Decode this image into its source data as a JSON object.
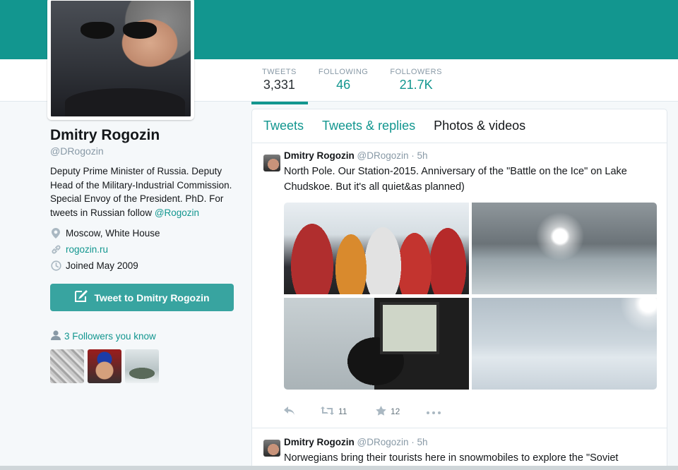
{
  "profile": {
    "name": "Dmitry Rogozin",
    "handle": "@DRogozin",
    "bio_text": "Deputy Prime Minister of Russia. Deputy Head of the Military-Industrial Commission. Special Envoy of the President. PhD. For tweets in Russian follow ",
    "bio_link": "@Rogozin",
    "location": "Moscow, White House",
    "website": "rogozin.ru",
    "joined": "Joined May 2009",
    "tweet_button": "Tweet to Dmitry Rogozin",
    "followers_you_know": "3 Followers you know"
  },
  "stats": [
    {
      "label": "TWEETS",
      "value": "3,331"
    },
    {
      "label": "FOLLOWING",
      "value": "46"
    },
    {
      "label": "FOLLOWERS",
      "value": "21.7K"
    }
  ],
  "timeline_tabs": [
    "Tweets",
    "Tweets & replies",
    "Photos & videos"
  ],
  "tweets": [
    {
      "name": "Dmitry Rogozin",
      "handle": "@DRogozin",
      "time": "5h",
      "text": "North Pole. Our Station-2015. Anniversary of the \"Battle on the Ice\" on Lake Chudskoe. But it's all quiet&as planned)",
      "retweets": "11",
      "favorites": "12"
    },
    {
      "name": "Dmitry Rogozin",
      "handle": "@DRogozin",
      "time": "5h",
      "text": "Norwegians bring their tourists here in snowmobiles to explore the \"Soviet"
    }
  ],
  "colors": {
    "accent": "#12968f",
    "banner": "#12968f",
    "button": "#38a4a0"
  }
}
